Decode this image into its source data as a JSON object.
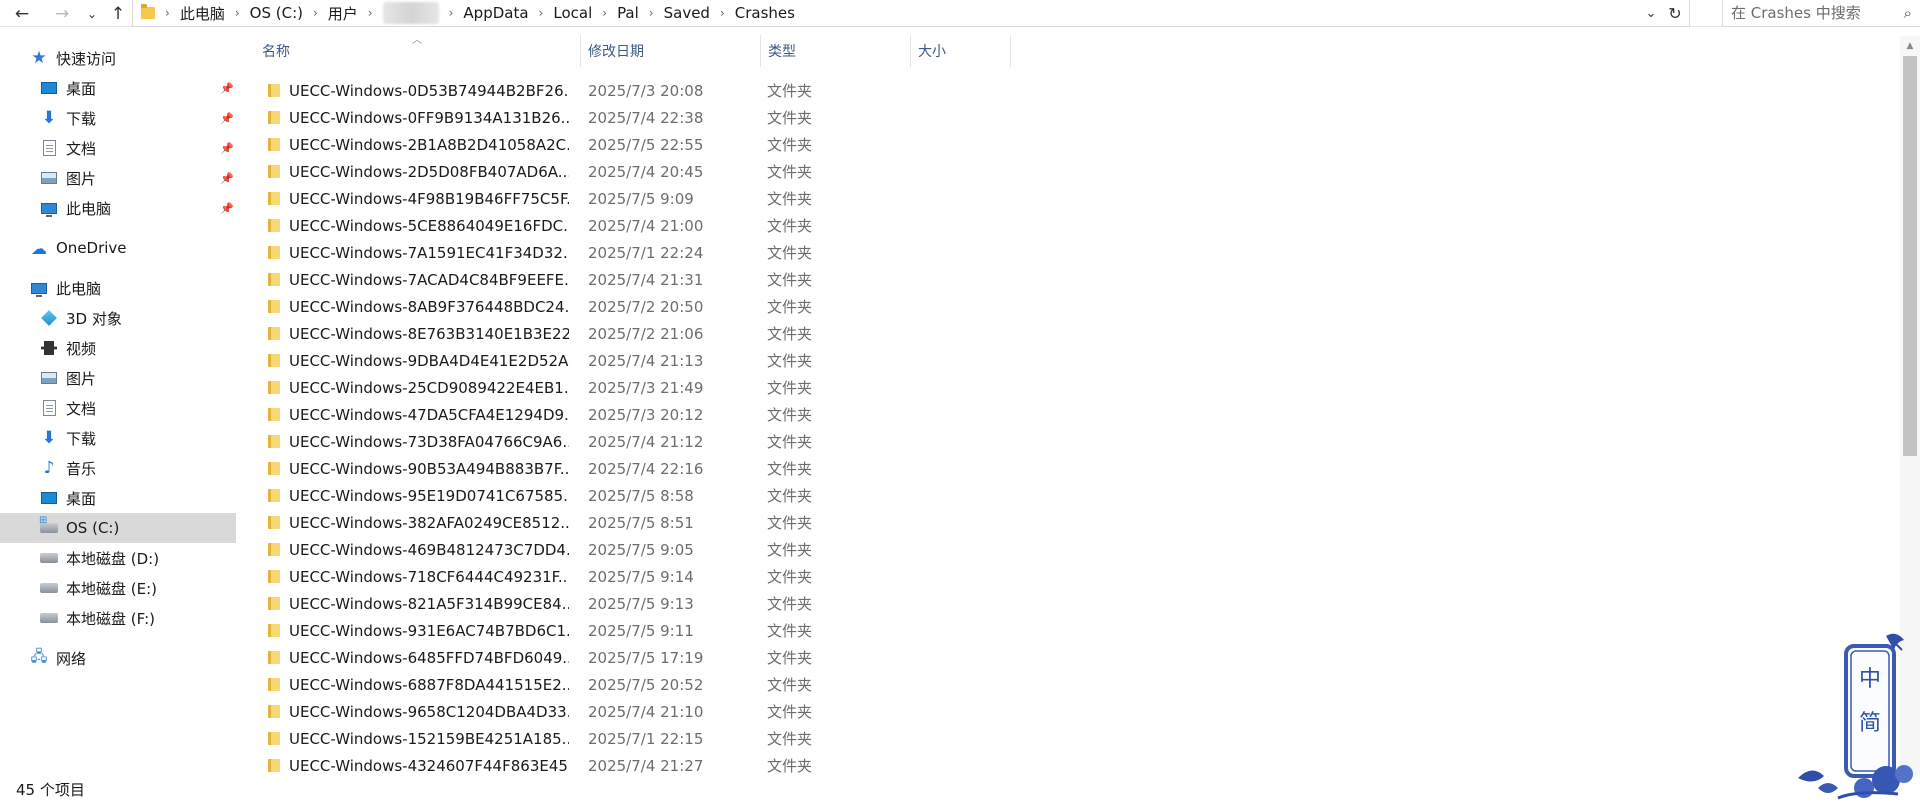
{
  "address_bar": {
    "breadcrumbs": [
      "此电脑",
      "OS (C:)",
      "用户",
      "",
      "AppData",
      "Local",
      "Pal",
      "Saved",
      "Crashes"
    ],
    "search_placeholder": "在 Crashes 中搜索"
  },
  "sidebar": {
    "quick_access": "快速访问",
    "pinned": [
      {
        "label": "桌面",
        "icon": "desktop-icon"
      },
      {
        "label": "下载",
        "icon": "download-icon"
      },
      {
        "label": "文档",
        "icon": "document-icon"
      },
      {
        "label": "图片",
        "icon": "picture-icon"
      },
      {
        "label": "此电脑",
        "icon": "computer-icon"
      }
    ],
    "onedrive": "OneDrive",
    "this_pc": "此电脑",
    "pc_items": [
      {
        "label": "3D 对象",
        "icon": "3d-objects-icon"
      },
      {
        "label": "视频",
        "icon": "video-icon"
      },
      {
        "label": "图片",
        "icon": "picture-icon"
      },
      {
        "label": "文档",
        "icon": "document-icon"
      },
      {
        "label": "下载",
        "icon": "download-icon"
      },
      {
        "label": "音乐",
        "icon": "music-icon"
      },
      {
        "label": "桌面",
        "icon": "desktop-icon"
      },
      {
        "label": "OS (C:)",
        "icon": "system-drive-icon",
        "selected": true
      },
      {
        "label": "本地磁盘 (D:)",
        "icon": "drive-icon"
      },
      {
        "label": "本地磁盘 (E:)",
        "icon": "drive-icon"
      },
      {
        "label": "本地磁盘 (F:)",
        "icon": "drive-icon"
      }
    ],
    "network": "网络"
  },
  "columns": {
    "name": "名称",
    "date": "修改日期",
    "type": "类型",
    "size": "大小"
  },
  "files": [
    {
      "name": "UECC-Windows-0D53B74944B2BF26...",
      "date": "2025/7/3 20:08",
      "type": "文件夹"
    },
    {
      "name": "UECC-Windows-0FF9B9134A131B26...",
      "date": "2025/7/4 22:38",
      "type": "文件夹"
    },
    {
      "name": "UECC-Windows-2B1A8B2D41058A2C...",
      "date": "2025/7/5 22:55",
      "type": "文件夹"
    },
    {
      "name": "UECC-Windows-2D5D08FB407AD6A...",
      "date": "2025/7/4 20:45",
      "type": "文件夹"
    },
    {
      "name": "UECC-Windows-4F98B19B46FF75C5F...",
      "date": "2025/7/5 9:09",
      "type": "文件夹"
    },
    {
      "name": "UECC-Windows-5CE8864049E16FDC...",
      "date": "2025/7/4 21:00",
      "type": "文件夹"
    },
    {
      "name": "UECC-Windows-7A1591EC41F34D32...",
      "date": "2025/7/1 22:24",
      "type": "文件夹"
    },
    {
      "name": "UECC-Windows-7ACAD4C84BF9EEFE...",
      "date": "2025/7/4 21:31",
      "type": "文件夹"
    },
    {
      "name": "UECC-Windows-8AB9F376448BDC24...",
      "date": "2025/7/2 20:50",
      "type": "文件夹"
    },
    {
      "name": "UECC-Windows-8E763B3140E1B3E22...",
      "date": "2025/7/2 21:06",
      "type": "文件夹"
    },
    {
      "name": "UECC-Windows-9DBA4D4E41E2D52A...",
      "date": "2025/7/4 21:13",
      "type": "文件夹"
    },
    {
      "name": "UECC-Windows-25CD9089422E4EB1...",
      "date": "2025/7/3 21:49",
      "type": "文件夹"
    },
    {
      "name": "UECC-Windows-47DA5CFA4E1294D9...",
      "date": "2025/7/3 20:12",
      "type": "文件夹"
    },
    {
      "name": "UECC-Windows-73D38FA04766C9A6...",
      "date": "2025/7/4 21:12",
      "type": "文件夹"
    },
    {
      "name": "UECC-Windows-90B53A494B883B7F...",
      "date": "2025/7/4 22:16",
      "type": "文件夹"
    },
    {
      "name": "UECC-Windows-95E19D0741C67585...",
      "date": "2025/7/5 8:58",
      "type": "文件夹"
    },
    {
      "name": "UECC-Windows-382AFA0249CE8512...",
      "date": "2025/7/5 8:51",
      "type": "文件夹"
    },
    {
      "name": "UECC-Windows-469B4812473C7DD4...",
      "date": "2025/7/5 9:05",
      "type": "文件夹"
    },
    {
      "name": "UECC-Windows-718CF6444C49231F...",
      "date": "2025/7/5 9:14",
      "type": "文件夹"
    },
    {
      "name": "UECC-Windows-821A5F314B99CE84...",
      "date": "2025/7/5 9:13",
      "type": "文件夹"
    },
    {
      "name": "UECC-Windows-931E6AC74B7BD6C1...",
      "date": "2025/7/5 9:11",
      "type": "文件夹"
    },
    {
      "name": "UECC-Windows-6485FFD74BFD6049...",
      "date": "2025/7/5 17:19",
      "type": "文件夹"
    },
    {
      "name": "UECC-Windows-6887F8DA441515E2...",
      "date": "2025/7/5 20:52",
      "type": "文件夹"
    },
    {
      "name": "UECC-Windows-9658C1204DBA4D33...",
      "date": "2025/7/4 21:10",
      "type": "文件夹"
    },
    {
      "name": "UECC-Windows-152159BE4251A185...",
      "date": "2025/7/1 22:15",
      "type": "文件夹"
    },
    {
      "name": "UECC-Windows-4324607F44F863E45...",
      "date": "2025/7/4 21:27",
      "type": "文件夹"
    }
  ],
  "status": {
    "item_count": "45 个项目"
  },
  "watermark": {
    "text": "中简"
  },
  "colors": {
    "accent": "#1e8ad6",
    "selected_bg": "#d9d9d9",
    "folder": "#f8d775"
  }
}
